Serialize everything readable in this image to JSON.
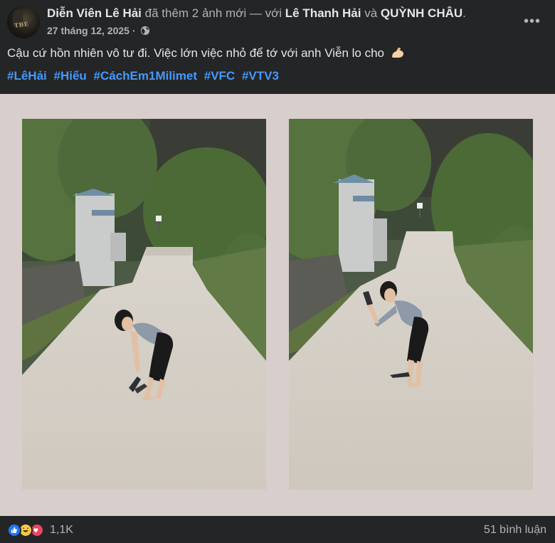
{
  "post": {
    "author": "Diễn Viên Lê Hải",
    "action_text": "đã thêm 2 ảnh mới — với",
    "tagged_1": "Lê Thanh Hải",
    "conjunction": "và",
    "tagged_2": "QUỲNH CHÂU",
    "end_punct": ".",
    "date": "27 tháng 12, 2025",
    "date_separator": "·",
    "audience_icon": "globe-icon",
    "more_label": "•••",
    "caption": "Cậu cứ hồn nhiên vô tư đi. Việc lớn việc nhỏ để tớ với anh Viễn lo cho",
    "caption_emoji": "flexed-biceps-emoji",
    "hashtags": [
      "#LêHải",
      "#Hiếu",
      "#CáchEm1Milimet",
      "#VFC",
      "#VTV3"
    ]
  },
  "colors": {
    "background": "#242526",
    "hashtag": "#4599ff",
    "media_background": "#d8cfcc",
    "like": "#2078f4",
    "haha": "#f7c94a",
    "love": "#f0445e"
  },
  "reactions": {
    "icons": [
      "like-icon",
      "haha-icon",
      "love-icon"
    ],
    "count": "1,1K"
  },
  "comments": {
    "count_label": "51 bình luận"
  }
}
